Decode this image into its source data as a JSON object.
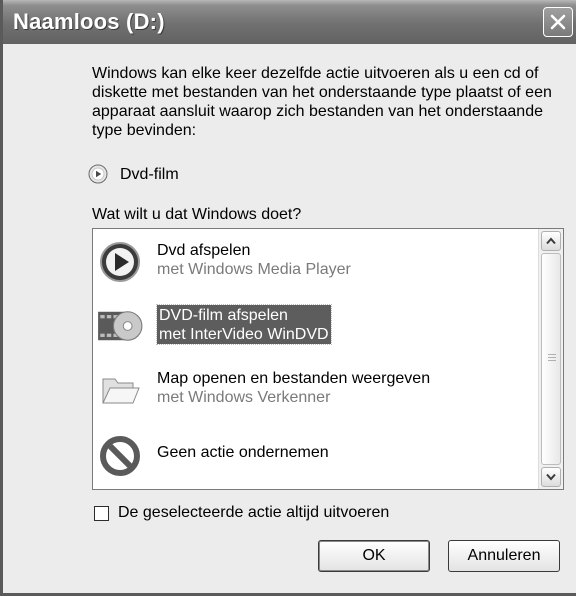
{
  "window": {
    "title": "Naamloos (D:)"
  },
  "intro_text": "Windows kan elke keer dezelfde actie uitvoeren als u een cd of diskette met bestanden van het onderstaande type plaatst of een apparaat aansluit waarop zich bestanden van het onderstaande type bevinden:",
  "content_type": {
    "label": "Dvd-film",
    "icon": "dvd-disc-icon"
  },
  "question": "Wat wilt u dat Windows doet?",
  "actions": [
    {
      "title": "Dvd afspelen",
      "subtitle": "met Windows Media Player",
      "icon": "media-player-icon",
      "selected": false
    },
    {
      "title": "DVD-film afspelen",
      "subtitle": "met InterVideo WinDVD",
      "icon": "windvd-icon",
      "selected": true
    },
    {
      "title": "Map openen en bestanden weergeven",
      "subtitle": "met Windows Verkenner",
      "icon": "folder-open-icon",
      "selected": false
    },
    {
      "title": "Geen actie ondernemen",
      "subtitle": "",
      "icon": "no-action-icon",
      "selected": false
    }
  ],
  "always_do": {
    "label": "De geselecteerde actie altijd uitvoeren",
    "checked": false
  },
  "buttons": {
    "ok": "OK",
    "cancel": "Annuleren"
  }
}
